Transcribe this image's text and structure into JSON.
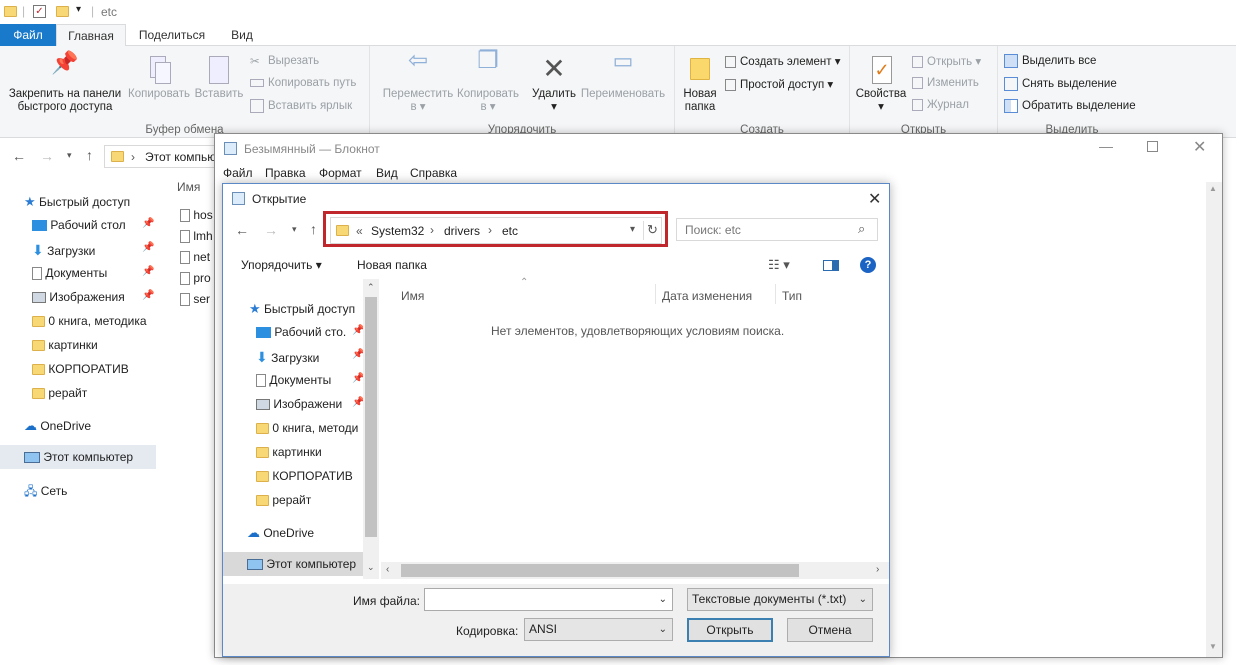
{
  "explorer": {
    "title": "etc",
    "tabs": {
      "file": "Файл",
      "home": "Главная",
      "share": "Поделиться",
      "view": "Вид"
    },
    "ribbon": {
      "clipboard": {
        "pin": "Закрепить на панели быстрого доступа",
        "pin_l1": "Закрепить на панели",
        "pin_l2": "быстрого доступа",
        "copy": "Копировать",
        "paste": "Вставить",
        "cut": "Вырезать",
        "copy_path": "Копировать путь",
        "paste_shortcut": "Вставить ярлык",
        "label": "Буфер обмена"
      },
      "organize": {
        "move_l1": "Переместить",
        "move_l2": "в ▾",
        "copy_l1": "Копировать",
        "copy_l2": "в ▾",
        "delete_l1": "Удалить",
        "delete_l2": "▾",
        "rename": "Переименовать",
        "label": "Упорядочить"
      },
      "create": {
        "new_folder_l1": "Новая",
        "new_folder_l2": "папка",
        "new_item": "Создать элемент ▾",
        "easy_access": "Простой доступ ▾",
        "label": "Создать"
      },
      "open": {
        "properties_l1": "Свойства",
        "properties_l2": "▾",
        "open": "Открыть ▾",
        "edit": "Изменить",
        "history": "Журнал",
        "label": "Открыть"
      },
      "select": {
        "select_all": "Выделить все",
        "select_none": "Снять выделение",
        "invert": "Обратить выделение",
        "label": "Выделить"
      }
    },
    "address": "Этот компью",
    "column_name": "Имя",
    "files": [
      "hos",
      "lmh",
      "net",
      "pro",
      "ser"
    ],
    "nav": {
      "quick_access": "Быстрый доступ",
      "items": [
        "Рабочий стол",
        "Загрузки",
        "Документы",
        "Изображения",
        "0 книга, методика",
        "картинки",
        "КОРПОРАТИВ",
        "рерайт"
      ],
      "onedrive": "OneDrive",
      "this_pc": "Этот компьютер",
      "network": "Сеть"
    }
  },
  "notepad": {
    "title": "Безымянный — Блокнот",
    "menu": [
      "Файл",
      "Правка",
      "Формат",
      "Вид",
      "Справка"
    ]
  },
  "dialog": {
    "title": "Открытие",
    "breadcrumb": {
      "prefix": "«",
      "parts": [
        "System32",
        "drivers",
        "etc"
      ]
    },
    "search_placeholder": "Поиск: etc",
    "organize": "Упорядочить ▾",
    "new_folder": "Новая папка",
    "columns": {
      "name": "Имя",
      "date": "Дата изменения",
      "type": "Тип"
    },
    "empty_message": "Нет элементов, удовлетворяющих условиям поиска.",
    "nav": {
      "quick_access": "Быстрый доступ",
      "items": [
        "Рабочий сто.",
        "Загрузки",
        "Документы",
        "Изображени",
        "0 книга, методи",
        "картинки",
        "КОРПОРАТИВ",
        "рерайт"
      ],
      "onedrive": "OneDrive",
      "this_pc": "Этот компьютер"
    },
    "filename_label": "Имя файла:",
    "filename_value": "",
    "filetype": "Текстовые документы (*.txt)",
    "encoding_label": "Кодировка:",
    "encoding_value": "ANSI",
    "open_button": "Открыть",
    "cancel_button": "Отмена"
  },
  "colors": {
    "accent": "#1979ca",
    "highlight": "#c0272d",
    "folder": "#f8d775"
  }
}
